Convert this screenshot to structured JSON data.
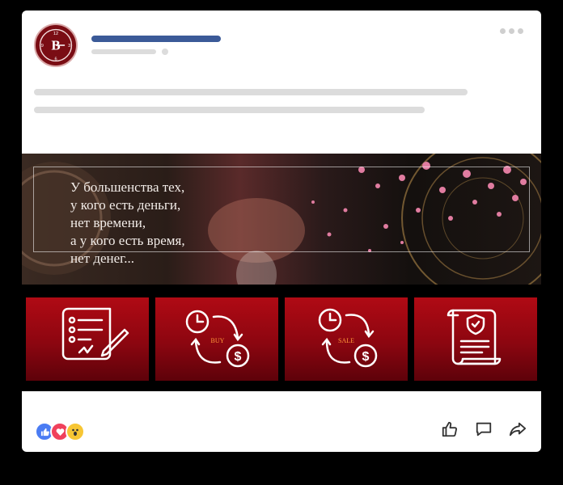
{
  "post": {
    "avatar_letter": "B",
    "avatar_numbers": [
      "12",
      "3",
      "6",
      "9"
    ],
    "banner_quote": "У большенства тех,\nу кого есть деньги,\nнет времени,\nа у кого есть время,\nнет денег...",
    "tiles": [
      {
        "icon": "contract-signing-icon",
        "label": ""
      },
      {
        "icon": "time-exchange-icon",
        "label": "BUY"
      },
      {
        "icon": "time-exchange-icon",
        "label": "SALE"
      },
      {
        "icon": "protected-document-icon",
        "label": ""
      }
    ],
    "reactions": [
      "like-icon",
      "love-icon",
      "wow-icon"
    ],
    "actions": [
      "like-action-icon",
      "comment-action-icon",
      "share-action-icon"
    ]
  },
  "colors": {
    "brand_red": "#7a0d14",
    "name_bar": "#3b5a98",
    "skeleton": "#dcdcdc",
    "tile_red": "#b00a14"
  }
}
